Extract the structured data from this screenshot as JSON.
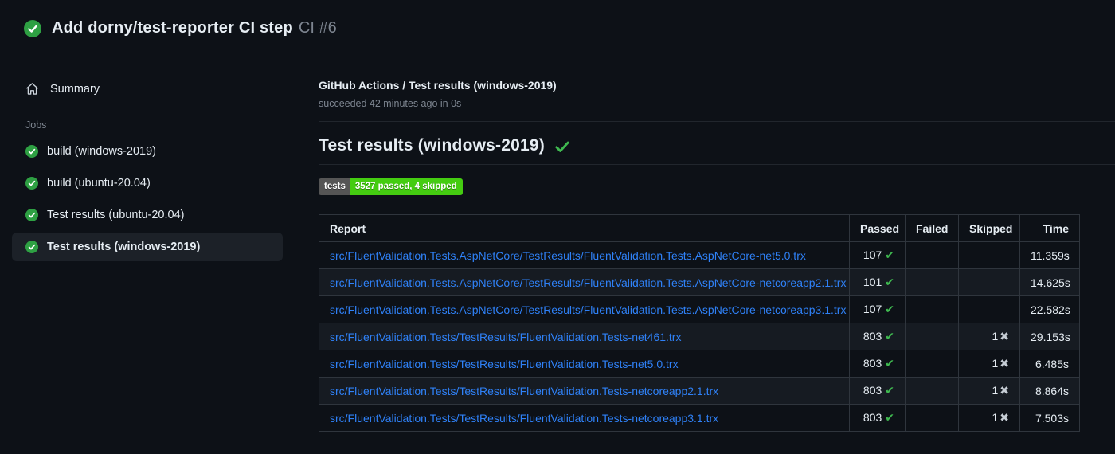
{
  "header": {
    "title": "Add dorny/test-reporter CI step",
    "run_number": "CI #6",
    "status_icon": "check-circle-icon"
  },
  "sidebar": {
    "summary_label": "Summary",
    "jobs_label": "Jobs",
    "jobs": [
      {
        "label": "build (windows-2019)",
        "status": "success",
        "selected": false
      },
      {
        "label": "build (ubuntu-20.04)",
        "status": "success",
        "selected": false
      },
      {
        "label": "Test results (ubuntu-20.04)",
        "status": "success",
        "selected": false
      },
      {
        "label": "Test results (windows-2019)",
        "status": "success",
        "selected": true
      }
    ]
  },
  "main": {
    "check_run_title": "GitHub Actions / Test results (windows-2019)",
    "check_run_status": "succeeded 42 minutes ago in 0s",
    "section_heading": "Test results (windows-2019)",
    "badge": {
      "label": "tests",
      "value": "3527 passed, 4 skipped",
      "label_bg": "#555555",
      "value_bg": "#44cc11"
    },
    "table": {
      "columns": [
        "Report",
        "Passed",
        "Failed",
        "Skipped",
        "Time"
      ],
      "rows": [
        {
          "report": "src/FluentValidation.Tests.AspNetCore/TestResults/FluentValidation.Tests.AspNetCore-net5.0.trx",
          "passed": "107",
          "failed": "",
          "skipped": "",
          "time": "11.359s"
        },
        {
          "report": "src/FluentValidation.Tests.AspNetCore/TestResults/FluentValidation.Tests.AspNetCore-netcoreapp2.1.trx",
          "passed": "101",
          "failed": "",
          "skipped": "",
          "time": "14.625s"
        },
        {
          "report": "src/FluentValidation.Tests.AspNetCore/TestResults/FluentValidation.Tests.AspNetCore-netcoreapp3.1.trx",
          "passed": "107",
          "failed": "",
          "skipped": "",
          "time": "22.582s"
        },
        {
          "report": "src/FluentValidation.Tests/TestResults/FluentValidation.Tests-net461.trx",
          "passed": "803",
          "failed": "",
          "skipped": "1",
          "time": "29.153s"
        },
        {
          "report": "src/FluentValidation.Tests/TestResults/FluentValidation.Tests-net5.0.trx",
          "passed": "803",
          "failed": "",
          "skipped": "1",
          "time": "6.485s"
        },
        {
          "report": "src/FluentValidation.Tests/TestResults/FluentValidation.Tests-netcoreapp2.1.trx",
          "passed": "803",
          "failed": "",
          "skipped": "1",
          "time": "8.864s"
        },
        {
          "report": "src/FluentValidation.Tests/TestResults/FluentValidation.Tests-netcoreapp3.1.trx",
          "passed": "803",
          "failed": "",
          "skipped": "1",
          "time": "7.503s"
        }
      ]
    }
  },
  "icons": {
    "pass_check": "✔",
    "skip_x": "✖"
  },
  "colors": {
    "page_bg": "#0d1117",
    "row_alt_bg": "#161b22",
    "selected_item_bg": "#1c2128",
    "success_circle": "#2ea043",
    "success_check": "#3fb950",
    "link_blue": "#2f81f7",
    "muted_text": "#7d8590",
    "table_border": "#2f353d"
  }
}
